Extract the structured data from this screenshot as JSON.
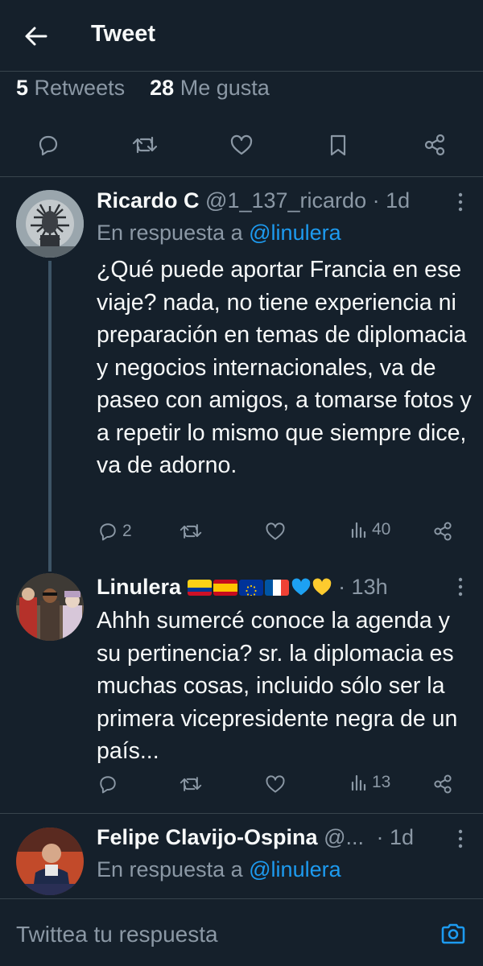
{
  "header": {
    "title": "Tweet"
  },
  "stats": {
    "retweets_count": "5",
    "retweets_label": "Retweets",
    "likes_count": "28",
    "likes_label": "Me gusta"
  },
  "tweets": [
    {
      "name": "Ricardo C",
      "handle": "@1_137_ricardo",
      "time": "· 1d",
      "reply_prefix": "En respuesta a",
      "reply_to": "@linulera",
      "body": "¿Qué puede aportar Francia en ese viaje? nada, no tiene experiencia ni preparación en temas de diplomacia y negocios internacionales, va de paseo con amigos, a tomarse  fotos y a repetir lo mismo que siempre dice, va de adorno.",
      "replies": "2",
      "views": "40"
    },
    {
      "name": "Linulera",
      "time": "· 13h",
      "body": "Ahhh sumercé conoce la agenda y su pertinencia? sr. la diplomacia es muchas cosas, incluido sólo ser la primera vicepresidente negra de un país...",
      "views": "13"
    },
    {
      "name": "Felipe Clavijo-Ospina",
      "handle": "@...",
      "time": "· 1d",
      "reply_prefix": "En respuesta a",
      "reply_to": "@linulera"
    }
  ],
  "composer": {
    "placeholder": "Twittea tu respuesta"
  },
  "colors": {
    "background": "#15202b",
    "accent": "#1d9bf0",
    "muted": "#8b98a5",
    "divider": "#38444d"
  }
}
